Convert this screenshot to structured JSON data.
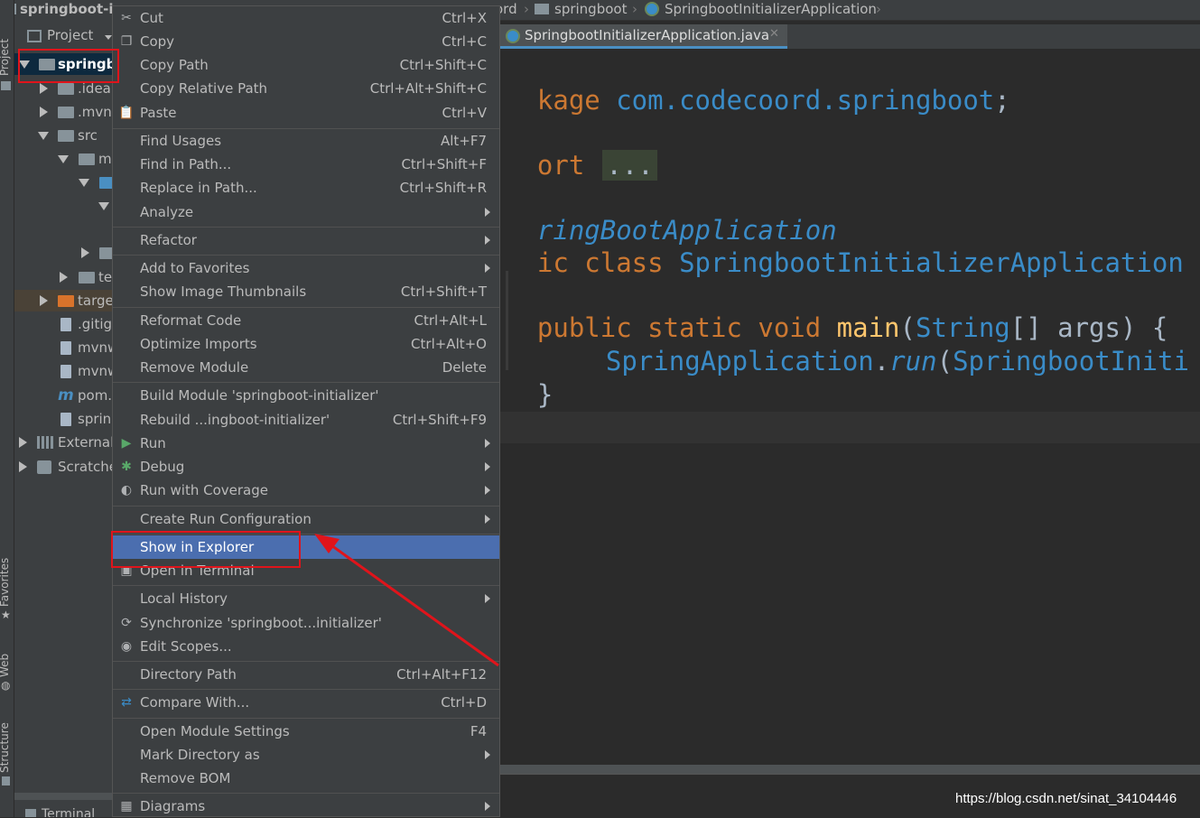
{
  "breadcrumb": {
    "project": "springboot-in",
    "seg1": "ord",
    "seg2": "springboot",
    "seg3": "SpringbootInitializerApplication"
  },
  "sidestrip": {
    "project": "Project",
    "favorites": "Favorites",
    "web": "Web",
    "structure": "Structure"
  },
  "project_panel": {
    "header": "Project",
    "tree": [
      {
        "label": "springbo",
        "kind": "module"
      },
      {
        "label": ".idea",
        "kind": "folder"
      },
      {
        "label": ".mvn",
        "kind": "folder"
      },
      {
        "label": "src",
        "kind": "folder"
      },
      {
        "label": "m",
        "kind": "folder"
      },
      {
        "label": "te",
        "kind": "folder"
      },
      {
        "label": "targe",
        "kind": "folder"
      },
      {
        "label": ".gitig",
        "kind": "file"
      },
      {
        "label": "mvnw",
        "kind": "file"
      },
      {
        "label": "mvnw",
        "kind": "file"
      },
      {
        "label": "pom.",
        "kind": "maven"
      },
      {
        "label": "sprin",
        "kind": "file"
      },
      {
        "label": "External",
        "kind": "library"
      },
      {
        "label": "Scratche",
        "kind": "scratch"
      }
    ]
  },
  "bottom_tab": "Terminal",
  "editor": {
    "tab_label": "SpringbootInitializerApplication.java",
    "lines": {
      "l1_kw": "kage",
      "l1_pkg": " com.codecoord.springboot",
      "l1_semi": ";",
      "l2_kw": "ort",
      "l2_fold": "...",
      "l3_ann": "ringBootApplication",
      "l4_kw": "ic class",
      "l4_cls": " SpringbootInitializerApplication",
      "l5_kw": "public static void",
      "l5_fn": " main",
      "l5_p1": "(",
      "l5_type": "String",
      "l5_p2": "[] args) {",
      "l6_cls": "SpringApplication",
      "l6_dot": ".",
      "l6_run": "run",
      "l6_p": "(",
      "l6_cls2": "SpringbootIniti",
      "l7": "}"
    }
  },
  "menu": {
    "items": [
      {
        "label": "Cut",
        "shortcut": "Ctrl+X",
        "icon": "scissors-icon"
      },
      {
        "label": "Copy",
        "shortcut": "Ctrl+C",
        "icon": "copy-icon"
      },
      {
        "label": "Copy Path",
        "shortcut": "Ctrl+Shift+C",
        "icon": ""
      },
      {
        "label": "Copy Relative Path",
        "shortcut": "Ctrl+Alt+Shift+C",
        "icon": ""
      },
      {
        "label": "Paste",
        "shortcut": "Ctrl+V",
        "icon": "paste-icon"
      },
      {
        "label": "Find Usages",
        "shortcut": "Alt+F7",
        "icon": ""
      },
      {
        "label": "Find in Path...",
        "shortcut": "Ctrl+Shift+F",
        "icon": ""
      },
      {
        "label": "Replace in Path...",
        "shortcut": "Ctrl+Shift+R",
        "icon": ""
      },
      {
        "label": "Analyze",
        "shortcut": "",
        "icon": "",
        "submenu": true
      },
      {
        "label": "Refactor",
        "shortcut": "",
        "icon": "",
        "submenu": true
      },
      {
        "label": "Add to Favorites",
        "shortcut": "",
        "icon": "",
        "submenu": true
      },
      {
        "label": "Show Image Thumbnails",
        "shortcut": "Ctrl+Shift+T",
        "icon": ""
      },
      {
        "label": "Reformat Code",
        "shortcut": "Ctrl+Alt+L",
        "icon": ""
      },
      {
        "label": "Optimize Imports",
        "shortcut": "Ctrl+Alt+O",
        "icon": ""
      },
      {
        "label": "Remove Module",
        "shortcut": "Delete",
        "icon": ""
      },
      {
        "label": "Build Module 'springboot-initializer'",
        "shortcut": "",
        "icon": ""
      },
      {
        "label": "Rebuild ...ingboot-initializer'",
        "shortcut": "Ctrl+Shift+F9",
        "icon": ""
      },
      {
        "label": "Run",
        "shortcut": "",
        "icon": "run-icon",
        "submenu": true
      },
      {
        "label": "Debug",
        "shortcut": "",
        "icon": "debug-icon",
        "submenu": true
      },
      {
        "label": "Run with Coverage",
        "shortcut": "",
        "icon": "coverage-icon",
        "submenu": true
      },
      {
        "label": "Create Run Configuration",
        "shortcut": "",
        "icon": "",
        "submenu": true
      },
      {
        "label": "Show in Explorer",
        "shortcut": "",
        "icon": "",
        "selected": true
      },
      {
        "label": "Open in Terminal",
        "shortcut": "",
        "icon": "terminal-icon"
      },
      {
        "label": "Local History",
        "shortcut": "",
        "icon": "",
        "submenu": true
      },
      {
        "label": "Synchronize 'springboot...initializer'",
        "shortcut": "",
        "icon": "sync-icon"
      },
      {
        "label": "Edit Scopes...",
        "shortcut": "",
        "icon": "scope-icon"
      },
      {
        "label": "Directory Path",
        "shortcut": "Ctrl+Alt+F12",
        "icon": ""
      },
      {
        "label": "Compare With...",
        "shortcut": "Ctrl+D",
        "icon": "compare-icon"
      },
      {
        "label": "Open Module Settings",
        "shortcut": "F4",
        "icon": ""
      },
      {
        "label": "Mark Directory as",
        "shortcut": "",
        "icon": "",
        "submenu": true
      },
      {
        "label": "Remove BOM",
        "shortcut": "",
        "icon": ""
      },
      {
        "label": "Diagrams",
        "shortcut": "",
        "icon": "diagram-icon",
        "submenu": true
      }
    ]
  },
  "watermark": "https://blog.csdn.net/sinat_34104446",
  "colors": {
    "selection": "#4b6eaf",
    "annotation_red": "#e0141b",
    "keyword": "#cc7832",
    "type": "#3a8cc8",
    "function": "#ffc66d"
  }
}
